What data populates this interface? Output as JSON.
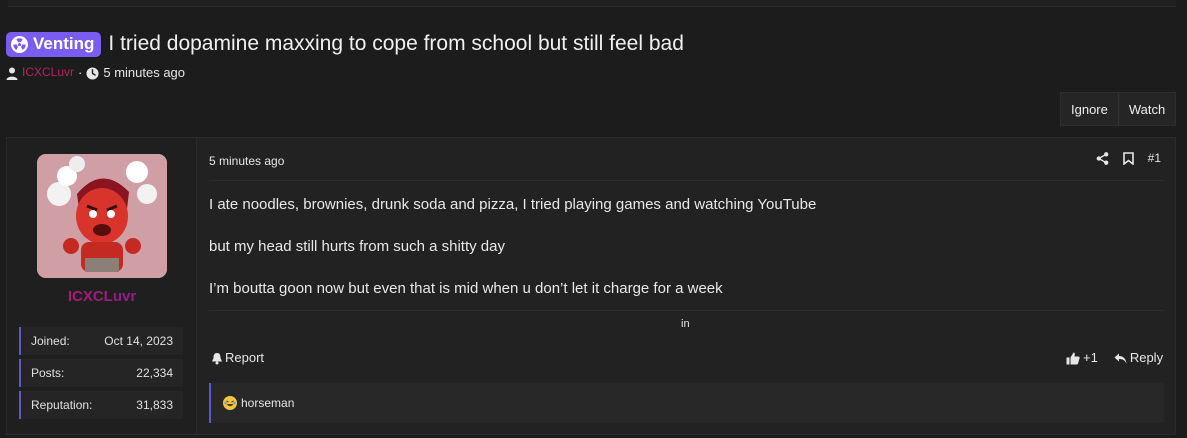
{
  "thread": {
    "prefix": "Venting",
    "title": "I tried dopamine maxxing to cope from school but still feel bad",
    "author": "ICXCLuvr",
    "separator": "·",
    "time": "5 minutes ago"
  },
  "actions": {
    "ignore": "Ignore",
    "watch": "Watch"
  },
  "post": {
    "time": "5 minutes ago",
    "number": "#1",
    "lines": [
      "I ate noodles, brownies, drunk soda and pizza, I tried playing games and watching YouTube",
      "but my head still hurts from such a shitty day",
      "I’m boutta goon now but even that is mid when u don’t let it charge for a week"
    ],
    "signature": "in",
    "report": "Report",
    "reaction_count": "+1",
    "reply": "Reply",
    "reaction_user": "horseman"
  },
  "user": {
    "name": "ICXCLuvr",
    "stats": [
      {
        "label": "Joined:",
        "value": "Oct 14, 2023"
      },
      {
        "label": "Posts:",
        "value": "22,334"
      },
      {
        "label": "Reputation:",
        "value": "31,833"
      }
    ]
  },
  "colors": {
    "prefix_bg": "#7b5cf0",
    "author": "#b5245f",
    "stat_accent": "#5a5acc"
  }
}
